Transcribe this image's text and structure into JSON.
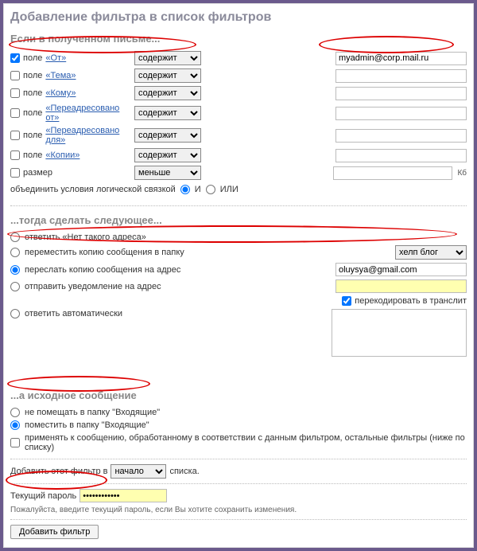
{
  "title": "Добавление фильтра в список фильтров",
  "sections": {
    "if": "Если в полученном письме...",
    "then": "...тогда сделать следующее...",
    "orig": "...а исходное сообщение"
  },
  "ops": {
    "contains": "содержит",
    "less": "меньше"
  },
  "conditions": [
    {
      "id": "from",
      "checked": true,
      "prefix": "поле ",
      "link": "«От»",
      "op": "contains",
      "value": "myadmin@corp.mail.ru"
    },
    {
      "id": "subject",
      "checked": false,
      "prefix": "поле ",
      "link": "«Тема»",
      "op": "contains",
      "value": ""
    },
    {
      "id": "to",
      "checked": false,
      "prefix": "поле ",
      "link": "«Кому»",
      "op": "contains",
      "value": ""
    },
    {
      "id": "redirfrom",
      "checked": false,
      "prefix": "поле ",
      "link": "«Переадресовано от»",
      "op": "contains",
      "value": ""
    },
    {
      "id": "redirto",
      "checked": false,
      "prefix": "поле ",
      "link": "«Переадресовано для»",
      "op": "contains",
      "value": ""
    },
    {
      "id": "cc",
      "checked": false,
      "prefix": "поле ",
      "link": "«Копии»",
      "op": "contains",
      "value": ""
    },
    {
      "id": "size",
      "checked": false,
      "prefix": "",
      "link": "",
      "label": "размер",
      "op": "less",
      "value": "",
      "unit": "Кб"
    }
  ],
  "logic": {
    "text": "объединить условия логической связкой",
    "and": "И",
    "or": "ИЛИ",
    "selected": "and"
  },
  "actions": {
    "reject": "ответить «Нет такого адреса»",
    "copyfolder": "переместить копию сообщения в папку",
    "forward": "переслать копию сообщения на адрес",
    "notify": "отправить уведомление на адрес",
    "autoreply": "ответить автоматически",
    "selected": "forward",
    "folder_options": [
      "хелп блог"
    ],
    "folder_selected": "хелп блог",
    "forward_value": "oluysya@gmail.com",
    "notify_value": "",
    "translit_checked": true,
    "translit_label": "перекодировать в транслит",
    "autoreply_value": ""
  },
  "orig": {
    "skip_inbox": "не помещать в папку \"Входящие\"",
    "put_inbox": "поместить в папку \"Входящие\"",
    "selected": "put_inbox",
    "apply_other_checked": false,
    "apply_other": "применять к сообщению, обработанному в соответствии с данным фильтром, остальные фильтры (ниже по списку)"
  },
  "placement": {
    "before": "Добавить этот фильтр в",
    "options": [
      "начало"
    ],
    "selected": "начало",
    "after": "списка."
  },
  "password": {
    "label": "Текущий пароль",
    "value": "••••••••••••",
    "note": "Пожалуйста, введите текущий пароль, если Вы хотите сохранить изменения."
  },
  "submit": "Добавить фильтр"
}
